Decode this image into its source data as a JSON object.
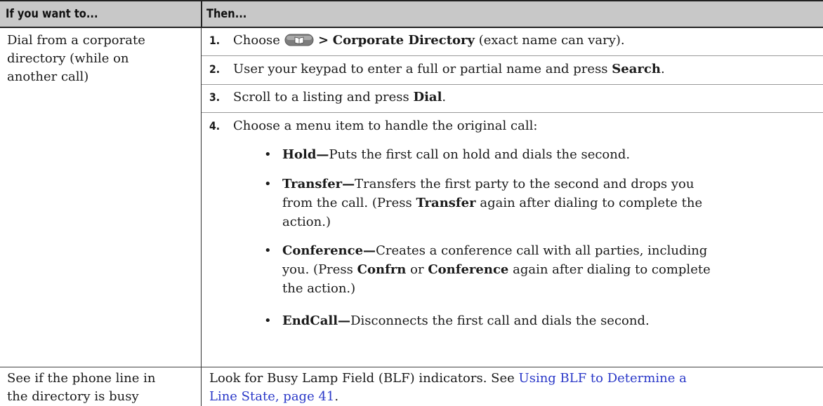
{
  "header": {
    "col1": "If you want to...",
    "col2": "Then..."
  },
  "row1": {
    "left_lines": [
      "Dial from a corporate",
      "directory (while on",
      "another call)"
    ],
    "steps": [
      {
        "num": "1.",
        "pre": "Choose",
        "icon": "directories-button-icon",
        "gt": ">",
        "bold": "Corporate Directory",
        "post": "(exact name can vary)."
      },
      {
        "num": "2.",
        "pre": "User your keypad to enter a full or partial name and press",
        "bold": "Search",
        "post": "."
      },
      {
        "num": "3.",
        "pre": "Scroll to a listing and press",
        "bold": "Dial",
        "post": "."
      },
      {
        "num": "4.",
        "text": "Choose a menu item to handle the original call:"
      }
    ],
    "bullets": {
      "hold": {
        "bold": "Hold—",
        "text": "Puts the first call on hold and dials the second."
      },
      "transfer": {
        "bold": "Transfer—",
        "line1": "Transfers the first party to the second and drops you",
        "line2_pre": "from the call. (Press",
        "line2_bold": "Transfer",
        "line2_post": "again after dialing to complete the",
        "line3": "action.)"
      },
      "conference": {
        "bold": "Conference—",
        "line1": "Creates a conference call with all parties, including",
        "line2_pre": "you. (Press",
        "line2_bold1": "Confrn",
        "line2_mid": "or",
        "line2_bold2": "Conference",
        "line2_post": "again after dialing to complete",
        "line3": "the action.)"
      },
      "endcall": {
        "bold": "EndCall—",
        "text": "Disconnects the first call and dials the second."
      }
    }
  },
  "row2": {
    "left_lines": [
      "See if the phone line in",
      "the directory is busy"
    ],
    "line1_pre": "Look for Busy Lamp Field (BLF) indicators. See",
    "link_line1": "Using BLF to Determine a",
    "link_line2": "Line State, page 41",
    "line2_post": "."
  }
}
